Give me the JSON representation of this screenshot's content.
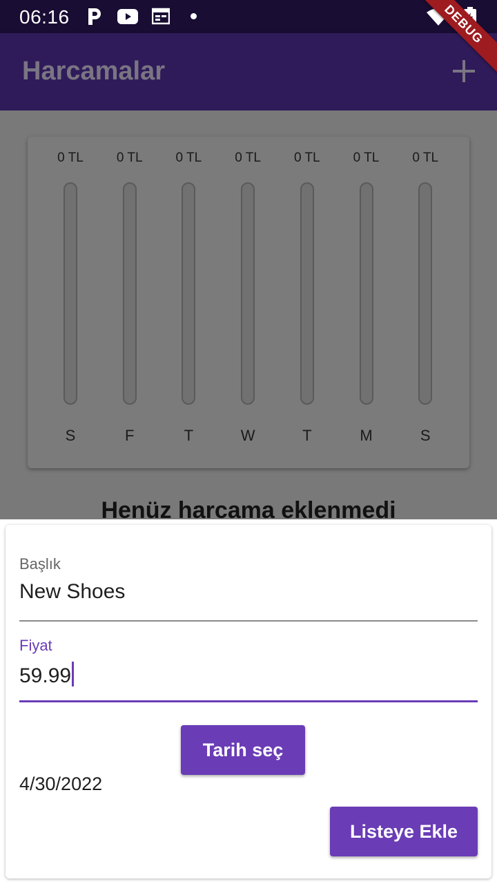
{
  "status_bar": {
    "time": "06:16",
    "icons": [
      "p-app-icon",
      "youtube-icon",
      "calendar-icon",
      "notification-dot-icon",
      "wifi-icon",
      "battery-icon"
    ]
  },
  "debug_banner": "DEBUG",
  "app_bar": {
    "title": "Harcamalar",
    "action_icon": "add-icon"
  },
  "chart": {
    "bars": [
      {
        "day": "S",
        "amount": "0 TL",
        "fraction": 0
      },
      {
        "day": "F",
        "amount": "0 TL",
        "fraction": 0
      },
      {
        "day": "T",
        "amount": "0 TL",
        "fraction": 0
      },
      {
        "day": "W",
        "amount": "0 TL",
        "fraction": 0
      },
      {
        "day": "T",
        "amount": "0 TL",
        "fraction": 0
      },
      {
        "day": "M",
        "amount": "0 TL",
        "fraction": 0
      },
      {
        "day": "S",
        "amount": "0 TL",
        "fraction": 0
      }
    ]
  },
  "empty_message": "Henüz harcama eklenmedi",
  "form": {
    "title_label": "Başlık",
    "title_value": "New Shoes",
    "price_label": "Fiyat",
    "price_value": "59.99",
    "date_value": "4/30/2022",
    "date_button": "Tarih seç",
    "submit_button": "Listeye Ekle"
  },
  "colors": {
    "primary": "#6a3cb6",
    "app_bar": "#2f1b5a",
    "status_bar": "#190d33",
    "debug": "#9e1b20"
  }
}
